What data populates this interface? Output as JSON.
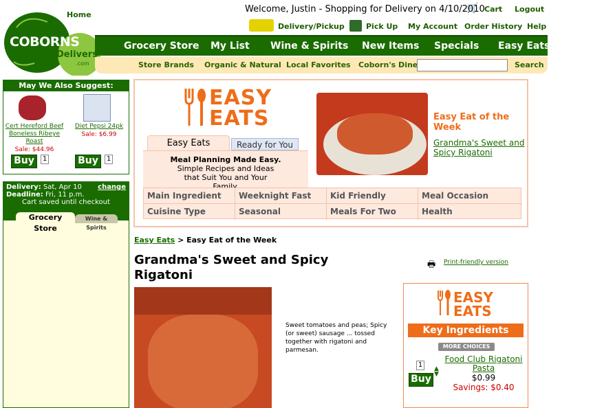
{
  "header": {
    "home_link": "Home",
    "welcome": "Welcome, Justin - Shopping for Delivery on 4/10/2010",
    "cart": "Cart",
    "logout": "Logout",
    "delivery_pickup": "Delivery/Pickup",
    "pick_up": "Pick Up",
    "my_account": "My Account",
    "order_history": "Order History",
    "help": "Help",
    "logo_text": "COBORNS",
    "logo_sub": "Delivers",
    "logo_com": ".com"
  },
  "nav": [
    "Grocery Store",
    "My List",
    "Wine & Spirits",
    "New Items",
    "Specials",
    "Easy Eats"
  ],
  "subnav": [
    "Store Brands",
    "Organic & Natural",
    "Local Favorites",
    "Coborn's Diner"
  ],
  "search": {
    "button": "Search",
    "placeholder": ""
  },
  "suggest": {
    "title": "May We Also Suggest:",
    "items": [
      {
        "name": "Cert Hereford Beef Boneless Ribeye Roast",
        "price": "Sale: $44.96",
        "buy": "Buy",
        "qty": "1"
      },
      {
        "name": "Diet Pepsi 24pk",
        "price": "Sale: $6.99",
        "buy": "Buy",
        "qty": "1"
      }
    ]
  },
  "delivery": {
    "delivery_label": "Delivery:",
    "delivery_value": "Sat, Apr 10",
    "change": "change",
    "deadline_label": "Deadline:",
    "deadline_value": "Fri, 11 p.m.",
    "cart_saved": "Cart saved until checkout",
    "tab_grocery": "Grocery Store",
    "tab_wine": "Wine & Spirits"
  },
  "easyeats": {
    "logo_top": "EASY",
    "logo_bottom": "EATS",
    "tab_active": "Easy Eats",
    "tab_other": "Ready for You",
    "tagline_bold": "Meal Planning Made Easy.",
    "tagline": "Simple Recipes and Ideas that Suit You and Your Family.",
    "feature_title": "Easy Eat of the Week",
    "feature_recipe": "Grandma's Sweet and Spicy Rigatoni",
    "grid": [
      "Main Ingredient",
      "Weeknight Fast",
      "Kid Friendly",
      "Meal Occasion",
      "Cuisine Type",
      "Seasonal",
      "Meals For Two",
      "Health"
    ]
  },
  "breadcrumb": {
    "link": "Easy Eats",
    "rest": " > Easy Eat of the Week"
  },
  "recipe": {
    "title": "Grandma's Sweet and Spicy Rigatoni",
    "print": "Print-friendly version",
    "description": "Sweet tomatoes and peas; Spicy (or sweet) sausage ... tossed together with rigatoni and parmesan."
  },
  "ingredients": {
    "logo_top": "EASY",
    "logo_bottom": "EATS",
    "title": "Key Ingredients",
    "more": "MORE CHOICES",
    "item_name": "Food Club Rigatoni Pasta",
    "item_price": "$0.99",
    "item_savings": "Savings: $0.40",
    "buy": "Buy",
    "qty": "1"
  },
  "colors": {
    "green": "#1a6c00",
    "orange": "#ee6d1a",
    "cream": "#fde8b6",
    "lime": "#8dc63f"
  }
}
